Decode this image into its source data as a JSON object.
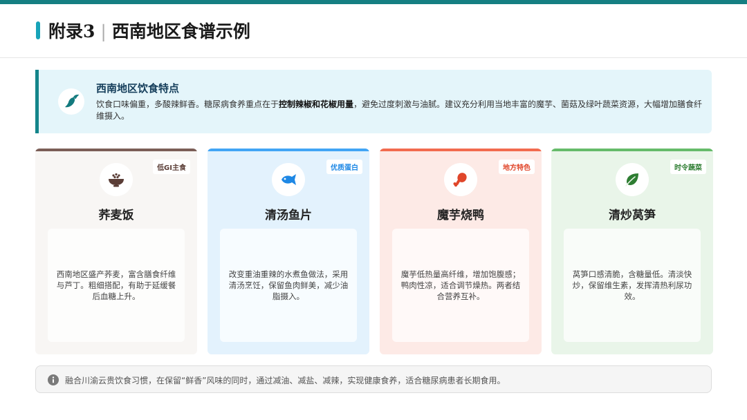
{
  "header": {
    "appendix": "附录3",
    "separator": "|",
    "title": "西南地区食谱示例"
  },
  "intro": {
    "icon": "chili-pepper-icon",
    "heading": "西南地区饮食特点",
    "text_1": "饮食口味偏重，多酸辣鲜香。糖尿病食养重点在于",
    "bold": "控制辣椒和花椒用量",
    "text_2": "，避免过度刺激与油腻。建议充分利用当地丰富的魔芋、菌菇及绿叶蔬菜资源，大幅增加膳食纤维摄入。"
  },
  "cards": [
    {
      "badge": "低GI主食",
      "icon": "rice-bowl-icon",
      "name": "荞麦饭",
      "desc": "西南地区盛产荞麦，富含膳食纤维与芦丁。粗细搭配，有助于延缓餐后血糖上升。",
      "color": "#7b5e57"
    },
    {
      "badge": "优质蛋白",
      "icon": "fish-icon",
      "name": "清汤鱼片",
      "desc": "改变重油重辣的水煮鱼做法，采用清汤烹饪，保留鱼肉鲜美，减少油脂摄入。",
      "color": "#1e88e5"
    },
    {
      "badge": "地方特色",
      "icon": "drumstick-icon",
      "name": "魔芋烧鸭",
      "desc": "魔芋低热量高纤维，增加饱腹感；鸭肉性凉，适合调节燥热。两者结合营养互补。",
      "color": "#e0462a"
    },
    {
      "badge": "时令蔬菜",
      "icon": "leaf-icon",
      "name": "清炒莴笋",
      "desc": "莴笋口感清脆，含糖量低。清淡快炒，保留维生素，发挥清热利尿功效。",
      "color": "#2e7d32"
    }
  ],
  "footer": {
    "icon": "info-icon",
    "text": "融合川渝云贵饮食习惯，在保留“鲜香”风味的同时，通过减油、减盐、减辣，实现健康食养，适合糖尿病患者长期食用。"
  },
  "colors": {
    "top_bar": "#157f82",
    "accent": "#17a3b8",
    "intro_bg": "#e4f5fa"
  }
}
